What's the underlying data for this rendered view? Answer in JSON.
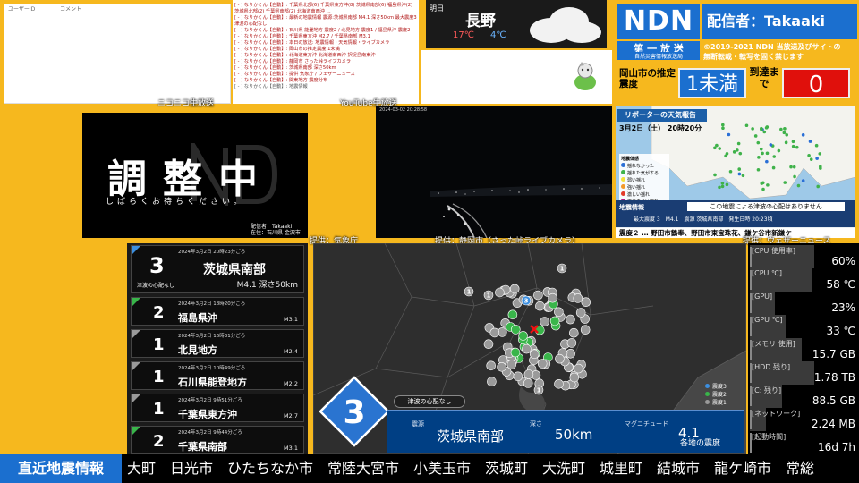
{
  "nico": {
    "col_user": "ユーザーID",
    "col_comment": "コメント",
    "caption": "ニコニコ生放送"
  },
  "youtube": {
    "caption": "YouTube生放送",
    "lines": [
      "[ - ] なりかくん【自動】: 千葉県北部(6)  千葉県東方沖(8) 茨城県南部(6) 福島県沖(2) 茨城県北部(2) 千葉県南部(2) 北海道南西沖 ...",
      "[ - ] なりかくん【自動】: 最新の地震情報 震源:茨城県南部 M4.1 深さ50km 最大震度3 津波の心配なし",
      "[ - ] なりかくん【自動】: 石川県 能登地方 震度2 / 北見地方 震度1 / 福島県沖 震度2",
      "[ - ] なりかくん【自動】: 千葉県東方沖 M2.7 / 千葉県南部 M3.1",
      "[ - ] なりかくん【自動】: 本日の放送: 地震情報・天気情報・ライブカメラ",
      "[ - ] なりかくん【自動】: 岡山市の推定震度 1未満",
      "[ - ] なりかくん【自動】: 北海道東方沖 北海道南西沖 択捉島南東沖",
      "[ - ] なりかくん【自動】: 静岡市 さった峠ライブカメラ",
      "[ - ] なりかくん【自動】: 茨城県南部 深さ50km",
      "[ - ] なりかくん【自動】: 提供 気象庁 / ウェザーニュース",
      "[ - ] なりかくん【自動】: 関東地方 震度分布",
      "[ - ] なりかくん【自動】: 地震情報"
    ]
  },
  "weather": {
    "tomorrow_label": "明日",
    "city": "長野",
    "max_temp": "17℃",
    "min_temp": "4℃"
  },
  "ndn": {
    "logo": "NDN",
    "broadcaster": "配信者：Takaaki",
    "channel": "第 一 放 送",
    "channel_sub": "自然災害情報放送局",
    "copyright_1": "©2019-2021 NDN 当放送及びサイトの",
    "copyright_2": "無断転載・転写を固く禁じます",
    "intensity_label": "岡山市の推定震度",
    "intensity_value": "1未満",
    "arrival_label": "到達まで",
    "arrival_value": "0"
  },
  "status_screen": {
    "title": "調整中",
    "subtitle": "しばらくお待ちください。",
    "by_1": "配信者：Takaaki",
    "by_2": "在住：石川県 金沢市",
    "caption": "提供：気象庁"
  },
  "camera": {
    "timestamp": "2024-03-02 20:28:58",
    "caption": "提供：静岡市（さった峠ライブカメラ）"
  },
  "weather_news": {
    "title": "リポーターの天気報告",
    "date": "3月2日（土） 20時20分",
    "legend_title": "地震体感",
    "legend": [
      "揺れなかった",
      "揺れた気がする",
      "弱い揺れ",
      "強い揺れ",
      "激しい揺れ",
      "すさまじい揺れ"
    ],
    "info_title": "地震情報",
    "info_message": "この地震による津波の心配はありません",
    "info_detail": "最大震度 3　M4.1　震源 茨城県南部　発生日時 20:23頃",
    "ticker": "震度２ … 野田市鶴奉、野田市東宝珠花、鎌ケ谷市新鎌ケ",
    "caption": "提供：ウェザーニュース",
    "colors": {
      "header": "#1c5fa8"
    }
  },
  "quake_list": [
    {
      "intensity": "3",
      "time": "2024年3月2日 20時23分ごろ",
      "place": "茨城県南部",
      "mag": "M4.1 深さ50km",
      "tsunami": "津波の心配なし",
      "color": "#3c8fe0"
    },
    {
      "intensity": "2",
      "time": "2024年3月2日 18時20分ごろ",
      "place": "福島県沖",
      "mag": "M3.1",
      "color": "#39b54a"
    },
    {
      "intensity": "1",
      "time": "2024年3月2日 16時31分ごろ",
      "place": "北見地方",
      "mag": "M2.4",
      "color": "#9a9a9a"
    },
    {
      "intensity": "1",
      "time": "2024年3月2日 10時49分ごろ",
      "place": "石川県能登地方",
      "mag": "M2.2",
      "color": "#9a9a9a"
    },
    {
      "intensity": "1",
      "time": "2024年3月2日 9時51分ごろ",
      "place": "千葉県東方沖",
      "mag": "M2.7",
      "color": "#9a9a9a"
    },
    {
      "intensity": "2",
      "time": "2024年3月2日 9時44分ごろ",
      "place": "千葉県南部",
      "mag": "M3.1",
      "color": "#39b54a"
    }
  ],
  "quake_map": {
    "max_intensity": "3",
    "tsunami": "津波の心配なし",
    "epicenter_label": "震源",
    "epicenter": "茨城県南部",
    "depth_label": "深さ",
    "depth": "50km",
    "mag_label": "マグニチュード",
    "mag": "4.1",
    "area_label": "各地の震度",
    "legend": [
      {
        "label": "震度3",
        "color": "#3c8fe0"
      },
      {
        "label": "震度2",
        "color": "#39b54a"
      },
      {
        "label": "震度1",
        "color": "#9a9a9a"
      }
    ]
  },
  "system": [
    {
      "label": "[CPU 使用率]",
      "value": "60%",
      "fill": 0.6
    },
    {
      "label": "[CPU ℃]",
      "value": "58 ℃",
      "fill": 0.58
    },
    {
      "label": "[GPU]",
      "value": "23%",
      "fill": 0.23
    },
    {
      "label": "[GPU ℃]",
      "value": "33 ℃",
      "fill": 0.33
    },
    {
      "label": "[メモリ 使用]",
      "value": "15.7 GB",
      "fill": 0.48
    },
    {
      "label": "[HDD 残り]",
      "value": "1.78 TB",
      "fill": 0.6
    },
    {
      "label": "[C: 残り]",
      "value": "88.5 GB",
      "fill": 0.3
    },
    {
      "label": "[ネットワーク]",
      "value": "2.24 MB",
      "fill": 0.15
    },
    {
      "label": "[起動時間]",
      "value": "16d 7h",
      "fill": 0
    }
  ],
  "ticker": {
    "label": "直近地震情報",
    "text": "大町　日光市　ひたちなか市　常陸大宮市　小美玉市　茨城町　大洗町　城里町　結城市　龍ケ崎市　常総"
  }
}
